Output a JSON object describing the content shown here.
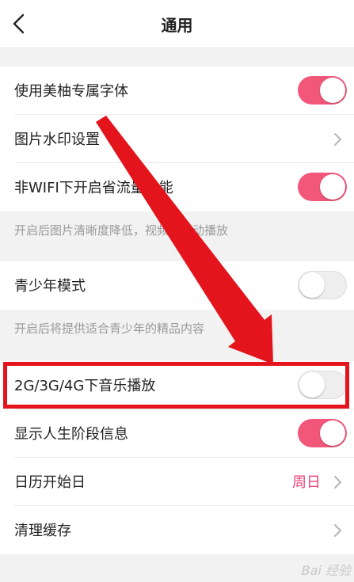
{
  "header": {
    "title": "通用",
    "back_icon": "chevron-left-icon"
  },
  "settings": {
    "font": {
      "label": "使用美柚专属字体",
      "enabled": true
    },
    "watermark": {
      "label": "图片水印设置"
    },
    "data_saver": {
      "label": "非WIFI下开启省流量功能",
      "enabled": true,
      "note": "开启后图片清晰度降低，视频不自动播放"
    },
    "teen_mode": {
      "label": "青少年模式",
      "enabled": false,
      "note": "开启后将提供适合青少年的精品内容"
    },
    "mobile_music": {
      "label": "2G/3G/4G下音乐播放",
      "enabled": false
    },
    "life_stage": {
      "label": "显示人生阶段信息",
      "enabled": true
    },
    "calendar_start": {
      "label": "日历开始日",
      "value": "周日"
    },
    "clear_cache": {
      "label": "清理缓存"
    }
  },
  "annotation": {
    "color": "#e3141c"
  },
  "colors": {
    "toggle_on": "#f2577a",
    "accent_text": "#e8427a"
  },
  "watermark_text": "Bai 经验"
}
